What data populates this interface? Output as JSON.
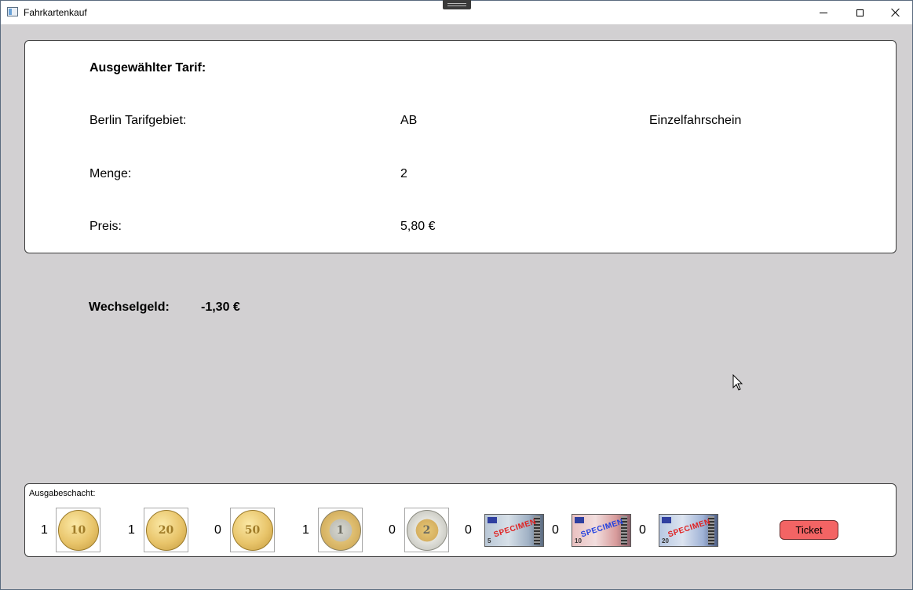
{
  "window": {
    "title": "Fahrkartenkauf"
  },
  "tariff": {
    "heading": "Ausgewählter Tarif:",
    "area_label": "Berlin Tarifgebiet:",
    "area_value": "AB",
    "ticket_type": "Einzelfahrschein",
    "quantity_label": "Menge:",
    "quantity_value": "2",
    "price_label": "Preis:",
    "price_value": "5,80 €"
  },
  "change": {
    "label": "Wechselgeld:",
    "value": "-1,30 €"
  },
  "output_tray": {
    "label": "Ausgabeschacht:",
    "items": [
      {
        "count": "1",
        "denomination": "10 cent",
        "face": "10",
        "kind": "coin-gold"
      },
      {
        "count": "1",
        "denomination": "20 cent",
        "face": "20",
        "kind": "coin-gold"
      },
      {
        "count": "0",
        "denomination": "50 cent",
        "face": "50",
        "kind": "coin-gold"
      },
      {
        "count": "1",
        "denomination": "1 euro",
        "face": "1",
        "kind": "coin-one"
      },
      {
        "count": "0",
        "denomination": "2 euro",
        "face": "2",
        "kind": "coin-two"
      },
      {
        "count": "0",
        "denomination": "5 euro",
        "face": "5",
        "specimen": "SPECIMEN",
        "kind": "note-5"
      },
      {
        "count": "0",
        "denomination": "10 euro",
        "face": "10",
        "specimen": "SPECIMEN",
        "kind": "note-10"
      },
      {
        "count": "0",
        "denomination": "20 euro",
        "face": "20",
        "specimen": "SPECIMEN",
        "kind": "note-20"
      }
    ],
    "ticket_button": "Ticket"
  },
  "colors": {
    "background": "#d2d0d2",
    "ticket_button": "#f36464"
  }
}
